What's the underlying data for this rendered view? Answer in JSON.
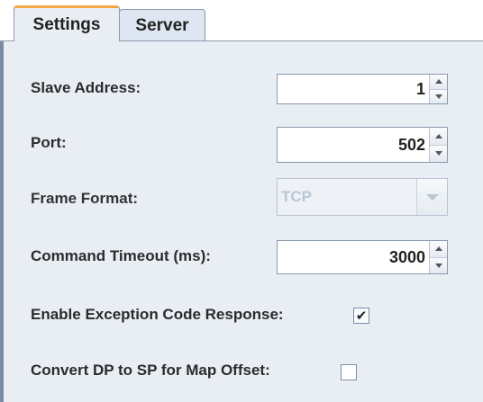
{
  "tabs": [
    {
      "label": "Settings",
      "selected": true
    },
    {
      "label": "Server",
      "selected": false
    }
  ],
  "fields": {
    "slave_address": {
      "label": "Slave Address:",
      "value": "1"
    },
    "port": {
      "label": "Port:",
      "value": "502"
    },
    "frame_format": {
      "label": "Frame Format:",
      "value": "TCP",
      "enabled": false
    },
    "command_timeout": {
      "label": "Command Timeout (ms):",
      "value": "3000"
    },
    "enable_exception": {
      "label": "Enable Exception Code Response:",
      "checked": true
    },
    "convert_dp": {
      "label": "Convert DP to SP for Map Offset:",
      "checked": false
    }
  },
  "icons": {
    "spin_up": "triangle-up",
    "spin_down": "triangle-down",
    "combo_arrow": "triangle-down",
    "check": "✔"
  },
  "colors": {
    "tab_accent": "#f3a74a",
    "panel_bg": "#e9eef5",
    "border": "#8a99ad",
    "disabled_text": "#b8c7d8"
  }
}
